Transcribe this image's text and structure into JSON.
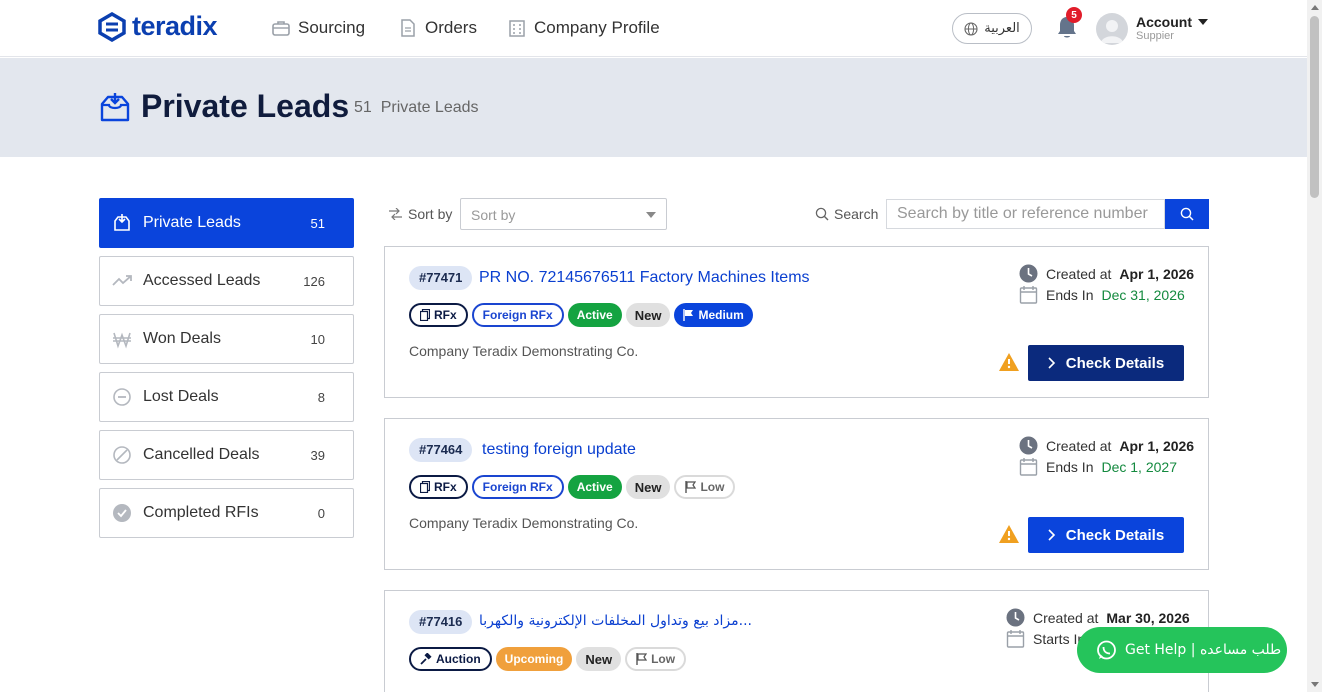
{
  "brand": {
    "name": "teradix",
    "color": "#0b3fb0"
  },
  "nav": {
    "links": [
      {
        "label": "Sourcing",
        "icon": "briefcase-icon"
      },
      {
        "label": "Orders",
        "icon": "document-icon"
      },
      {
        "label": "Company Profile",
        "icon": "building-icon"
      }
    ],
    "language": "العربية",
    "notifications": "5",
    "account": {
      "name": "Account",
      "role": "Suppier"
    }
  },
  "banner": {
    "title": "Private Leads",
    "count": "51",
    "count_label": "Private Leads"
  },
  "sidebar": {
    "items": [
      {
        "label": "Private Leads",
        "count": "51",
        "icon": "inbox-download-icon",
        "active": true
      },
      {
        "label": "Accessed Leads",
        "count": "126",
        "icon": "trend-up-icon"
      },
      {
        "label": "Won Deals",
        "count": "10",
        "icon": "won-currency-icon"
      },
      {
        "label": "Lost Deals",
        "count": "8",
        "icon": "minus-circle-icon"
      },
      {
        "label": "Cancelled Deals",
        "count": "39",
        "icon": "slash-circle-icon"
      },
      {
        "label": "Completed RFIs",
        "count": "0",
        "icon": "check-circle-icon"
      }
    ]
  },
  "toolbar": {
    "sort_label": "Sort by",
    "sort_placeholder": "Sort by",
    "search_label": "Search",
    "search_placeholder": "Search by title or reference number"
  },
  "leads": [
    {
      "ref": "#77471",
      "title": "PR NO. 72145676511 Factory Machines Items",
      "tags": [
        "RFx",
        "Foreign RFx",
        "Active",
        "New",
        "Medium"
      ],
      "company": "Company Teradix Demonstrating Co.",
      "created_label": "Created at",
      "created": "Apr 1, 2026",
      "end_label": "Ends In",
      "end": "Dec 31, 2026",
      "action": "Check Details"
    },
    {
      "ref": "#77464",
      "title": "testing foreign update",
      "tags": [
        "RFx",
        "Foreign RFx",
        "Active",
        "New",
        "Low"
      ],
      "company": "Company Teradix Demonstrating Co.",
      "created_label": "Created at",
      "created": "Apr 1, 2026",
      "end_label": "Ends In",
      "end": "Dec 1, 2027",
      "action": "Check Details"
    },
    {
      "ref": "#77416",
      "title": "مزاد بيع وتداول المخلفات الإلكترونية والكهربا...",
      "tags": [
        "Auction",
        "Upcoming",
        "New",
        "Low"
      ],
      "created_label": "Created at",
      "created": "Mar 30, 2026",
      "end_label": "Starts In"
    }
  ],
  "help": {
    "label": "Get Help | طلب مساعده"
  },
  "colors": {
    "primary": "#0a44dc",
    "active_green": "#14a341",
    "upcoming_orange": "#f0a03c",
    "help_green": "#25c45b",
    "alert_red": "#e11d2a"
  }
}
